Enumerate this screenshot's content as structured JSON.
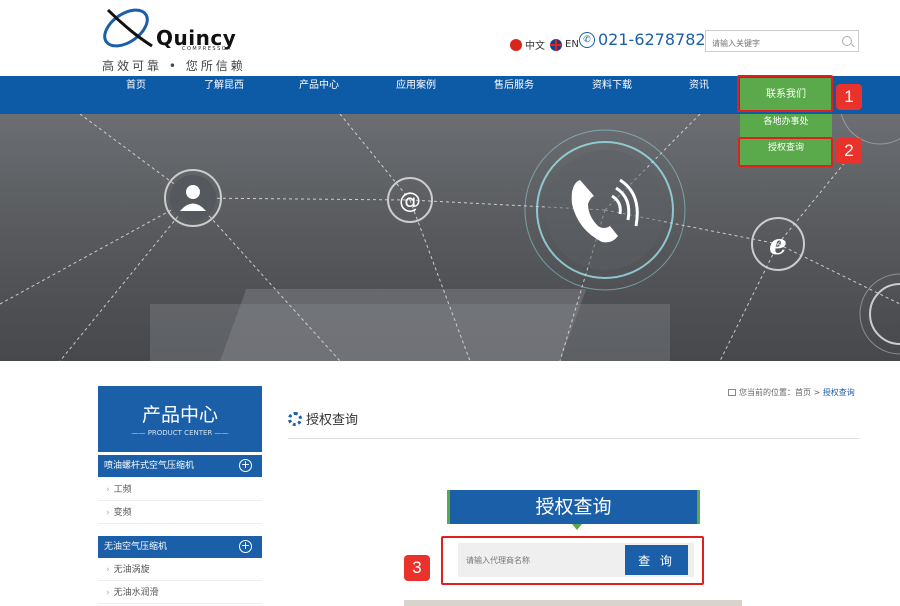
{
  "header": {
    "logo_word": "Quincy",
    "logo_sub": "COMPRESSOR",
    "tagline": "高效可靠 • 您所信赖",
    "lang_cn": "中文",
    "lang_en": "EN",
    "phone": "021-62787820",
    "search_placeholder": "请输入关键字"
  },
  "nav": {
    "items": [
      "首页",
      "了解昆西",
      "产品中心",
      "应用案例",
      "售后服务",
      "资料下载",
      "资讯",
      "联系我们"
    ],
    "active_index": 7,
    "dropdown": [
      "各地办事处",
      "授权查询"
    ]
  },
  "annotations": [
    "1",
    "2",
    "3"
  ],
  "sidebar": {
    "title": "产品中心",
    "title_en": "PRODUCT CENTER",
    "categories": [
      {
        "label": "喷油螺杆式空气压缩机",
        "subs": [
          "工频",
          "变频"
        ]
      },
      {
        "label": "无油空气压缩机",
        "subs": [
          "无油涡旋",
          "无油水润滑"
        ]
      }
    ]
  },
  "main": {
    "breadcrumb_prefix": "您当前的位置：",
    "breadcrumb_home": "首页",
    "breadcrumb_sep": ">",
    "breadcrumb_current": "授权查询",
    "title": "授权查询",
    "query_heading": "授权查询",
    "query_placeholder": "请输入代理商名称",
    "query_button": "查 询"
  },
  "colors": {
    "nav_blue": "#0d5aa7",
    "accent_green": "#5aa94a",
    "brand_blue": "#1b5fa8",
    "annotation_red": "#e8322b"
  }
}
